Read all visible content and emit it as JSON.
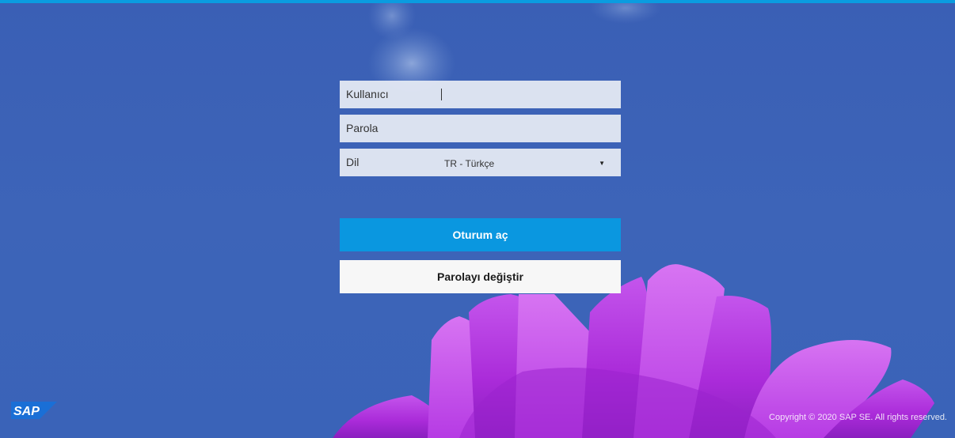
{
  "colors": {
    "accent": "#0a9ce0",
    "primary_button": "#0a97e0",
    "secondary_button": "#f7f7f7",
    "background_blue": "#3c62b6",
    "petal_magenta": "#b12ee0"
  },
  "login": {
    "username_label": "Kullanıcı",
    "username_value": "",
    "password_label": "Parola",
    "password_value": "",
    "language_label": "Dil",
    "language_value": "TR - Türkçe",
    "language_arrow": "▼",
    "logon_button": "Oturum aç",
    "change_password_button": "Parolayı değiştir"
  },
  "footer": {
    "logo_text": "SAP",
    "copyright": "Copyright © 2020 SAP SE. All rights reserved."
  }
}
